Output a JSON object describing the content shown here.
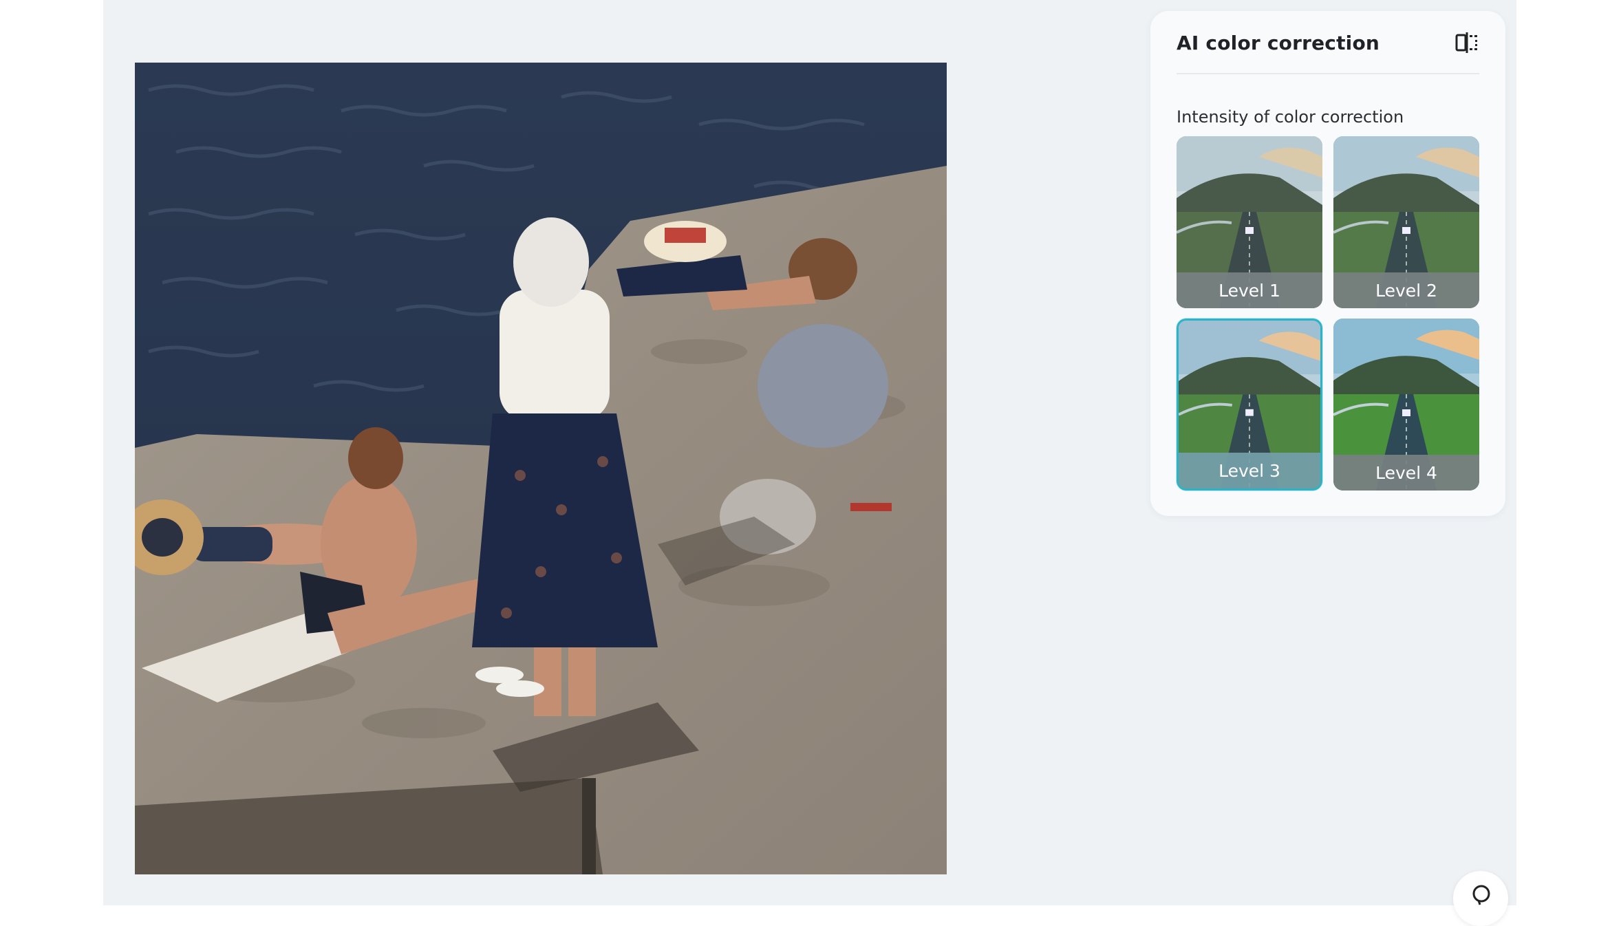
{
  "panel": {
    "title": "AI color correction",
    "section_label": "Intensity of color correction",
    "compare_icon": "compare-split-icon",
    "levels": [
      {
        "label": "Level 1",
        "selected": false
      },
      {
        "label": "Level 2",
        "selected": false
      },
      {
        "label": "Level 3",
        "selected": true
      },
      {
        "label": "Level 4",
        "selected": false
      }
    ]
  },
  "help_icon": "help-bubble-icon",
  "colors": {
    "accent": "#2bb3c8",
    "background": "#eef2f5",
    "panel": "#f8fafb"
  }
}
